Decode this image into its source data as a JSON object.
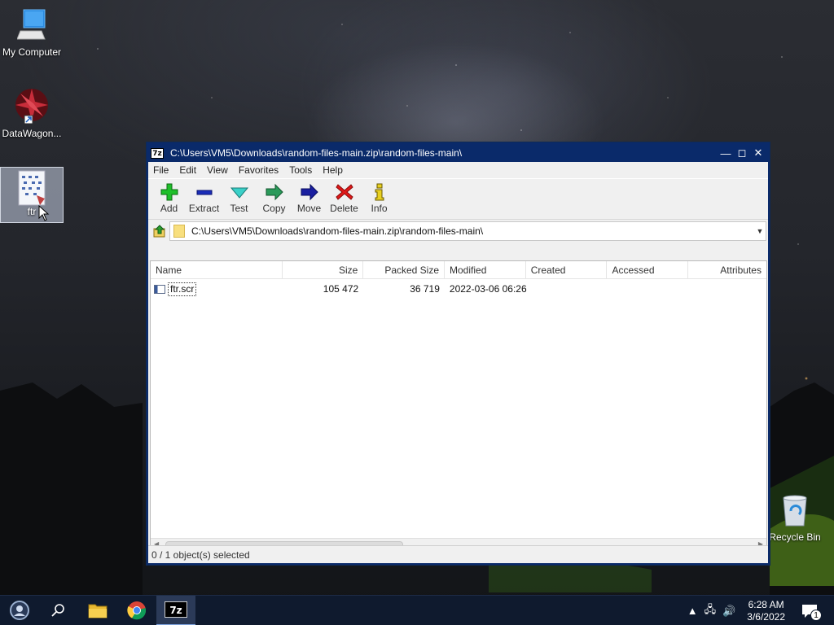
{
  "desktop": {
    "icons": [
      {
        "label": "My Computer"
      },
      {
        "label": "DataWagon..."
      },
      {
        "label": "ftr"
      },
      {
        "label": "Recycle Bin"
      }
    ]
  },
  "window": {
    "app_icon_text": "7z",
    "title": "C:\\Users\\VM5\\Downloads\\random-files-main.zip\\random-files-main\\",
    "menu": [
      "File",
      "Edit",
      "View",
      "Favorites",
      "Tools",
      "Help"
    ],
    "toolbar": [
      {
        "label": "Add",
        "icon": "plus-icon"
      },
      {
        "label": "Extract",
        "icon": "minus-icon"
      },
      {
        "label": "Test",
        "icon": "check-icon"
      },
      {
        "label": "Copy",
        "icon": "copy-arrow-icon"
      },
      {
        "label": "Move",
        "icon": "move-arrow-icon"
      },
      {
        "label": "Delete",
        "icon": "x-icon"
      },
      {
        "label": "Info",
        "icon": "info-icon"
      }
    ],
    "address": "C:\\Users\\VM5\\Downloads\\random-files-main.zip\\random-files-main\\",
    "columns": [
      "Name",
      "Size",
      "Packed Size",
      "Modified",
      "Created",
      "Accessed",
      "Attributes"
    ],
    "rows": [
      {
        "name": "ftr.scr",
        "size": "105 472",
        "packed": "36 719",
        "modified": "2022-03-06 06:26",
        "created": "",
        "accessed": "",
        "attributes": ""
      }
    ],
    "status": "0 / 1 object(s) selected"
  },
  "taskbar": {
    "time": "6:28 AM",
    "date": "3/6/2022",
    "notification_count": "1",
    "active_app_text": "7z"
  },
  "colors": {
    "titlebar": "#0a2a6a",
    "taskbar": "#0f1a2e"
  }
}
